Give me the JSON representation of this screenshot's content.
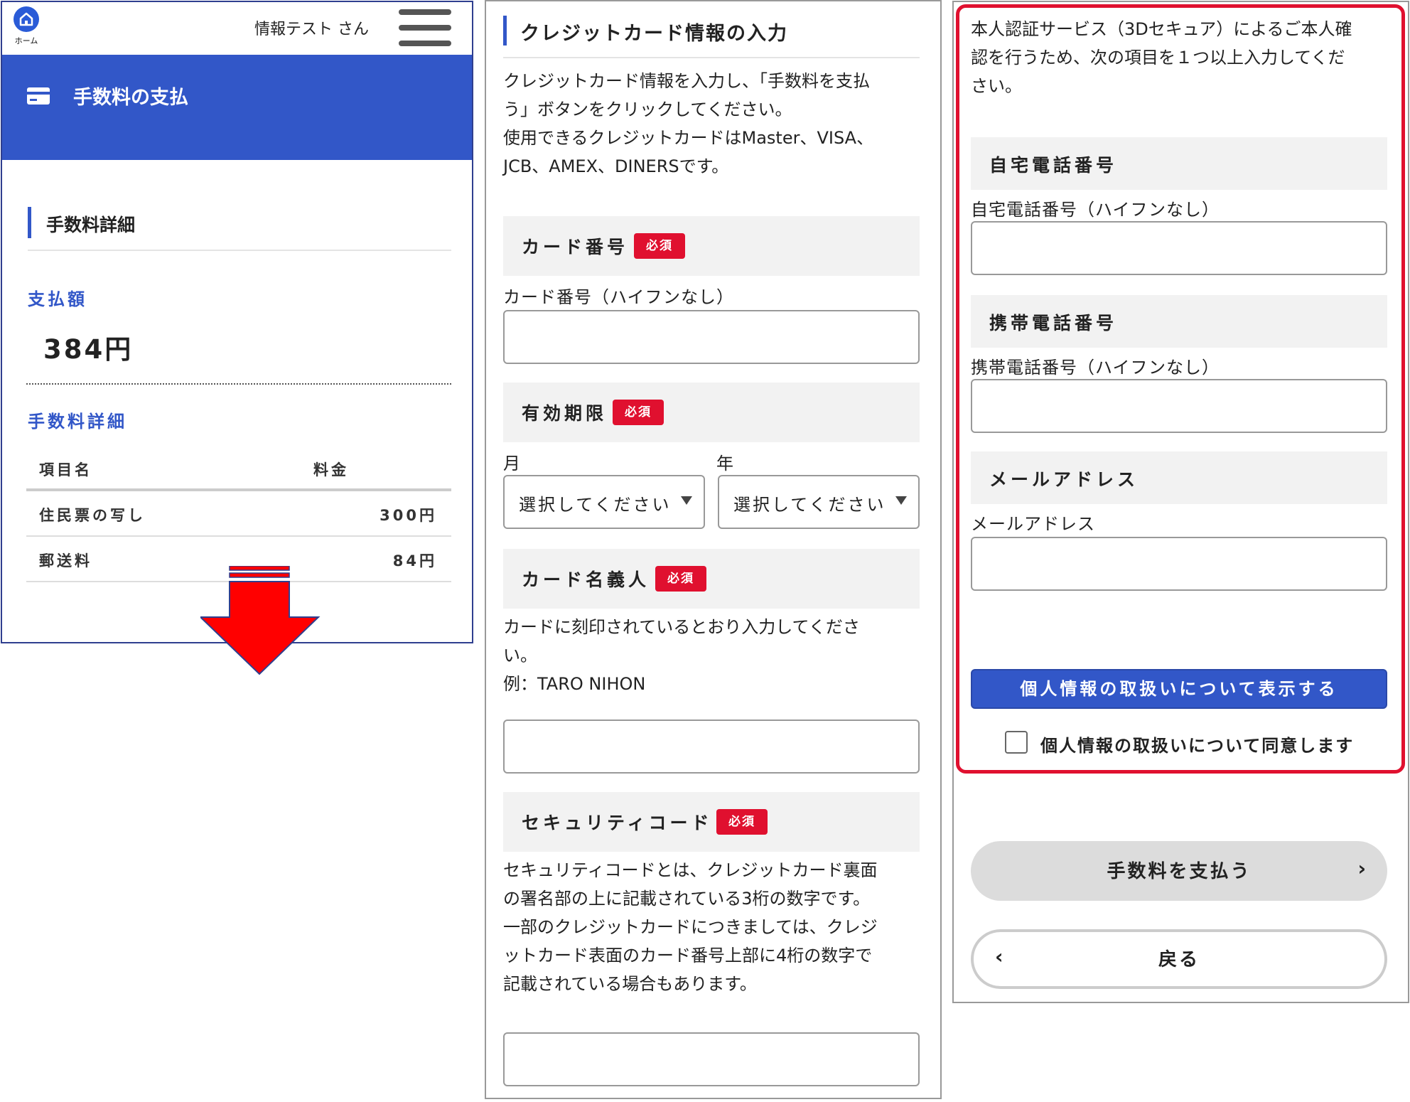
{
  "panel1": {
    "home_label": "ホーム",
    "user_name": "情報テスト さん",
    "banner_title": "手数料の支払",
    "section_title": "手数料詳細",
    "amount_label": "支払額",
    "amount_value": "384円",
    "detail_label": "手数料詳細",
    "table": {
      "headers": [
        "項目名",
        "料金"
      ],
      "rows": [
        {
          "item": "住民票の写し",
          "fee": "300円"
        },
        {
          "item": "郵送料",
          "fee": "84円"
        }
      ]
    }
  },
  "panel2": {
    "section_title": "クレジットカード情報の入力",
    "intro": [
      "クレジットカード情報を入力し、「手数料を支払",
      "う」ボタンをクリックしてください。",
      "使用できるクレジットカードはMaster、VISA、",
      "JCB、AMEX、DINERSです。"
    ],
    "required_badge": "必須",
    "card_number": {
      "title": "カード番号",
      "sublabel": "カード番号（ハイフンなし）",
      "value": ""
    },
    "expiry": {
      "title": "有効期限",
      "month_label": "月",
      "year_label": "年",
      "month_value": "選択してください",
      "year_value": "選択してください"
    },
    "card_holder": {
      "title": "カード名義人",
      "help": [
        "カードに刻印されているとおり入力してくださ",
        "い。",
        "例：TARO NIHON"
      ],
      "value": ""
    },
    "security_code": {
      "title": "セキュリティコード",
      "help": [
        "セキュリティコードとは、クレジットカード裏面",
        "の署名部の上に記載されている3桁の数字です。",
        "一部のクレジットカードにつきましては、クレジ",
        "ットカード表面のカード番号上部に4桁の数字で",
        "記載されている場合もあります。"
      ],
      "value": ""
    }
  },
  "panel3": {
    "intro": [
      "本人認証サービス（3Dセキュア）によるご本人確",
      "認を行うため、次の項目を１つ以上入力してくだ",
      "さい。"
    ],
    "home_phone": {
      "title": "自宅電話番号",
      "sublabel": "自宅電話番号（ハイフンなし）",
      "value": ""
    },
    "mobile_phone": {
      "title": "携帯電話番号",
      "sublabel": "携帯電話番号（ハイフンなし）",
      "value": ""
    },
    "email": {
      "title": "メールアドレス",
      "sublabel": "メールアドレス",
      "value": ""
    },
    "privacy_button": "個人情報の取扱いについて表示する",
    "agree_label": "個人情報の取扱いについて同意します",
    "agree_checked": false,
    "pay_button": "手数料を支払う",
    "back_button": "戻る"
  },
  "colors": {
    "brand_blue": "#3257c8",
    "required_red": "#e0102f",
    "highlight_red": "#e0102f",
    "arrow_red": "#ff0000"
  },
  "icons": [
    "home-icon",
    "hamburger-menu-icon",
    "credit-card-icon",
    "down-arrow-annotation",
    "chevron-down-icon",
    "chevron-right-icon",
    "chevron-left-icon"
  ]
}
